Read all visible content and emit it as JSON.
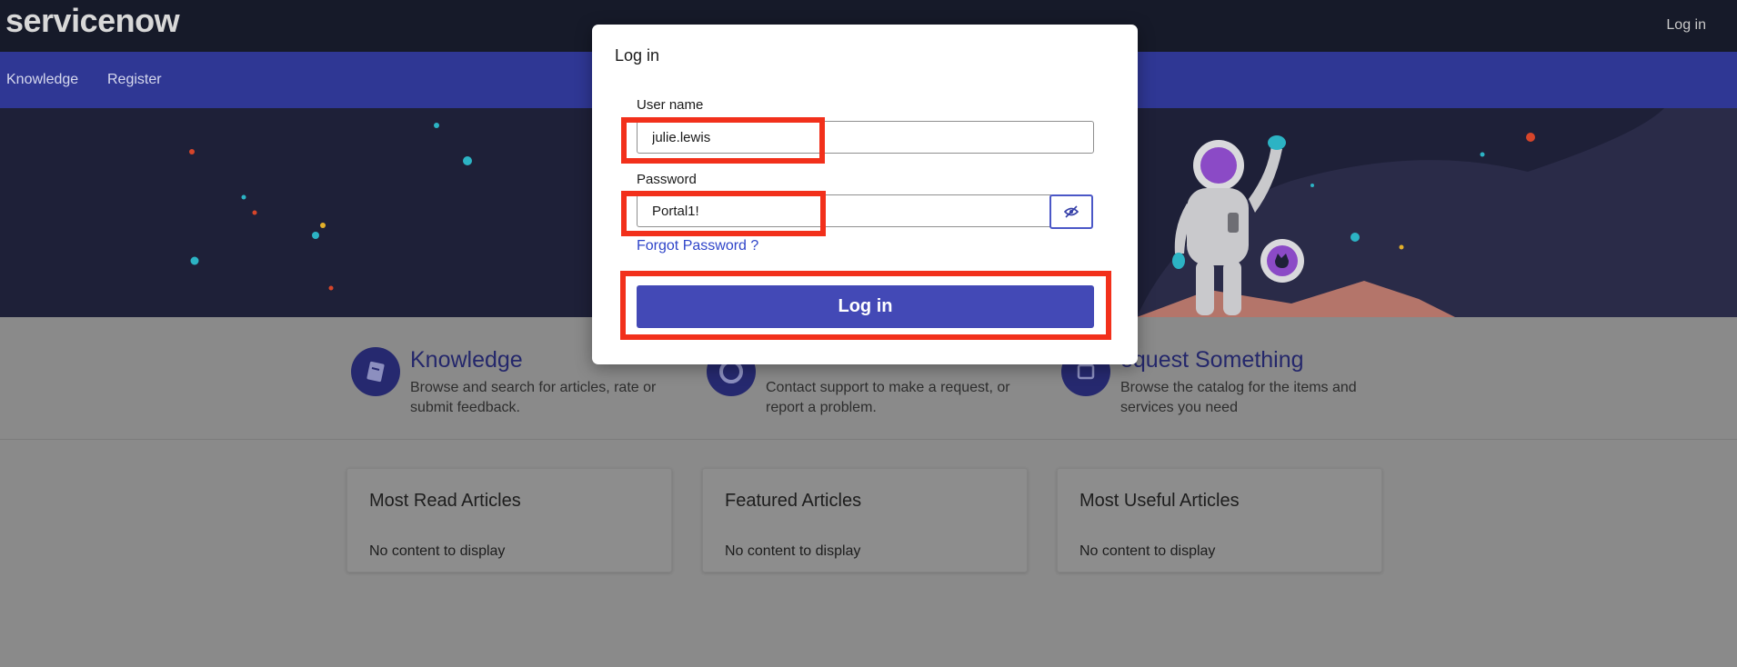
{
  "header": {
    "logo": "servicenow",
    "login_link": "Log in"
  },
  "nav": {
    "items": [
      "Knowledge",
      "Register"
    ]
  },
  "tiles": [
    {
      "title": "Knowledge",
      "description": "Browse and search for articles, rate or submit feedback.",
      "icon": "book-icon"
    },
    {
      "title": "",
      "description": "Contact support to make a request, or report a problem.",
      "icon": "lifebuoy-icon"
    },
    {
      "title": "equest Something",
      "description": "Browse the catalog for the items and services you need",
      "icon": "cart-icon"
    }
  ],
  "cards": [
    {
      "title": "Most Read Articles",
      "empty": "No content to display"
    },
    {
      "title": "Featured Articles",
      "empty": "No content to display"
    },
    {
      "title": "Most Useful Articles",
      "empty": "No content to display"
    }
  ],
  "modal": {
    "title": "Log in",
    "username_label": "User name",
    "username_value": "julie.lewis",
    "password_label": "Password",
    "password_value": "Portal1!",
    "forgot_label": "Forgot Password ?",
    "login_button": "Log in",
    "eye_icon": "eye-slash-icon"
  },
  "colors": {
    "highlight": "#f2301b",
    "primary_button": "#4349b6",
    "nav_bar": "#2f3794",
    "top_bar": "#161a29"
  }
}
